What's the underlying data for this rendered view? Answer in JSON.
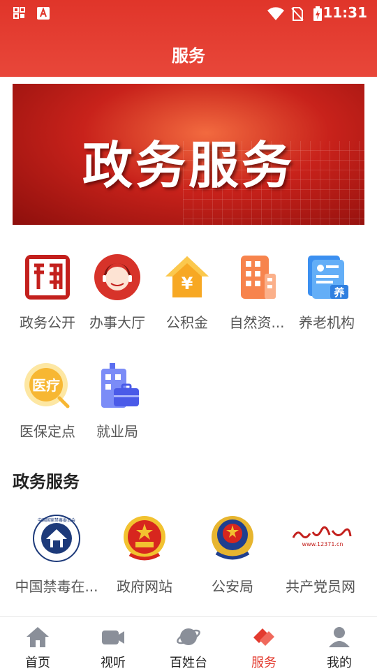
{
  "status_bar": {
    "time": "11:31"
  },
  "header": {
    "title": "服务"
  },
  "banner": {
    "text": "政务服务"
  },
  "services": [
    {
      "label": "政务公开",
      "icon": "seal-icon"
    },
    {
      "label": "办事大厅",
      "icon": "agent-icon"
    },
    {
      "label": "公积金",
      "icon": "house-yuan-icon"
    },
    {
      "label": "自然资...",
      "icon": "building-icon"
    },
    {
      "label": "养老机构",
      "icon": "pension-doc-icon"
    },
    {
      "label": "医保定点",
      "icon": "medical-insurance-icon"
    },
    {
      "label": "就业局",
      "icon": "briefcase-building-icon"
    }
  ],
  "gov_section": {
    "title": "政务服务",
    "items": [
      {
        "label": "中国禁毒在...",
        "icon": "narcotics-control-emblem-icon"
      },
      {
        "label": "政府网站",
        "icon": "national-emblem-icon"
      },
      {
        "label": "公安局",
        "icon": "police-emblem-icon"
      },
      {
        "label": "共产党员网",
        "icon": "party-member-logo-icon"
      }
    ]
  },
  "gov_logo_text": {
    "party_site_url": "www.12371.cn",
    "narcotics_name": "中国国家禁毒委员会"
  },
  "bottom_nav": [
    {
      "label": "首页",
      "icon": "home-icon",
      "active": false
    },
    {
      "label": "视听",
      "icon": "video-icon",
      "active": false
    },
    {
      "label": "百姓台",
      "icon": "planet-icon",
      "active": false
    },
    {
      "label": "服务",
      "icon": "service-hands-icon",
      "active": true
    },
    {
      "label": "我的",
      "icon": "user-icon",
      "active": false
    }
  ],
  "colors": {
    "brand_red": "#e33b2f",
    "active_nav": "#e33b2f"
  }
}
